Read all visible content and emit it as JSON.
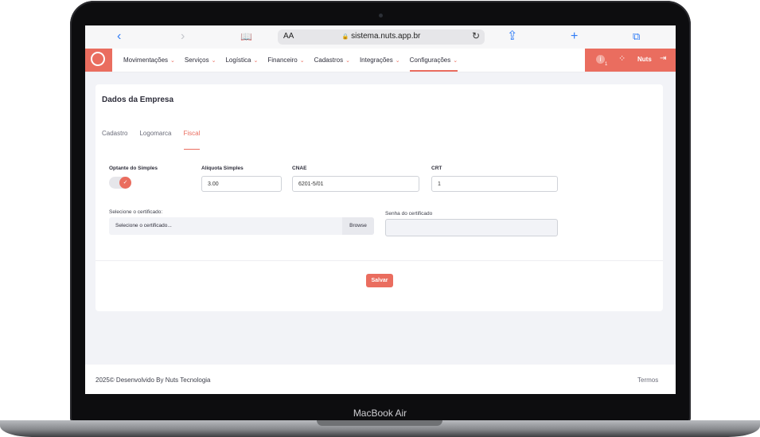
{
  "device": {
    "label": "MacBook Air"
  },
  "browser": {
    "back": "‹",
    "forward": "›",
    "text_size": "AA",
    "lock": "🔒",
    "url": "sistema.nuts.app.br",
    "reload": "↻",
    "share": "⇪",
    "new_tab": "+",
    "tabs": "⧉",
    "book": "📖"
  },
  "nav": {
    "menu": [
      {
        "label": "Movimentações",
        "active": false
      },
      {
        "label": "Serviços",
        "active": false
      },
      {
        "label": "Logística",
        "active": false
      },
      {
        "label": "Financeiro",
        "active": false
      },
      {
        "label": "Cadastros",
        "active": false
      },
      {
        "label": "Integrações",
        "active": false
      },
      {
        "label": "Configurações",
        "active": true
      }
    ],
    "chevron": "⌄",
    "info_icon": "i",
    "notification_count": "1",
    "user_name": "Nuts",
    "accent_color": "#ea6d5f"
  },
  "page": {
    "title": "Dados da Empresa",
    "tabs": [
      "Cadastro",
      "Logomarca",
      "Fiscal"
    ],
    "active_tab": "Fiscal",
    "fields": {
      "optante_label": "Optante do Simples",
      "optante_value": true,
      "aliquota_label": "Alíquota Simples",
      "aliquota_value": "3.00",
      "cnae_label": "CNAE",
      "cnae_value": "6201-5/01",
      "crt_label": "CRT",
      "crt_value": "1",
      "cert_label": "Selecione o certificado:",
      "cert_placeholder": "Selecione o certificado...",
      "browse_label": "Browse",
      "cert_password_label": "Senha do certificado",
      "cert_password_value": ""
    },
    "save_label": "Salvar"
  },
  "footer": {
    "copyright": "2025© Desenvolvido By Nuts Tecnologia",
    "terms": "Termos"
  }
}
